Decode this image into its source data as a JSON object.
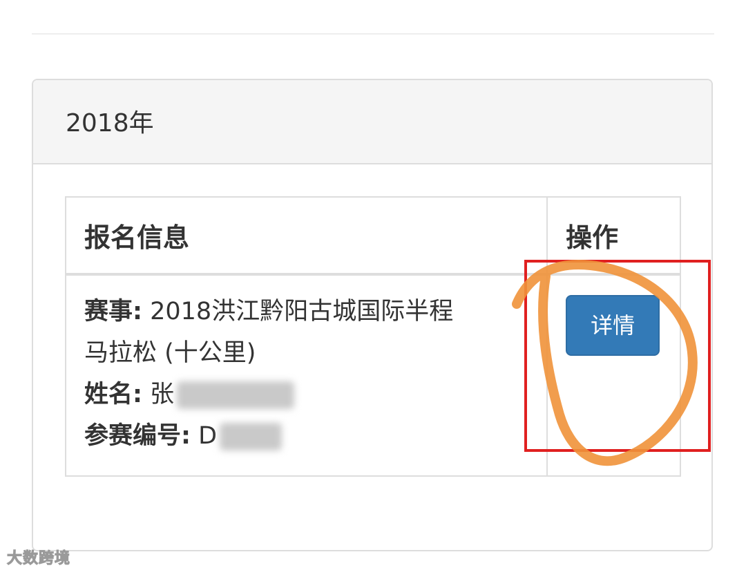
{
  "panel": {
    "title": "2018年"
  },
  "table": {
    "headers": {
      "info": "报名信息",
      "action": "操作"
    },
    "row": {
      "event_label": "赛事:",
      "event_value_line1": " 2018洪江黔阳古城国际半程",
      "event_value_line2": "马拉松 (十公里)",
      "name_label": "姓名:",
      "name_value_visible": " 张",
      "bib_label": "参赛编号:",
      "bib_value_visible": " D",
      "detail_button": "详情"
    }
  },
  "annotation": {
    "box_color": "#e02020",
    "scribble_color": "#f0923a"
  },
  "accent": {
    "button_color": "#337ab7"
  },
  "watermark": "大数跨境"
}
